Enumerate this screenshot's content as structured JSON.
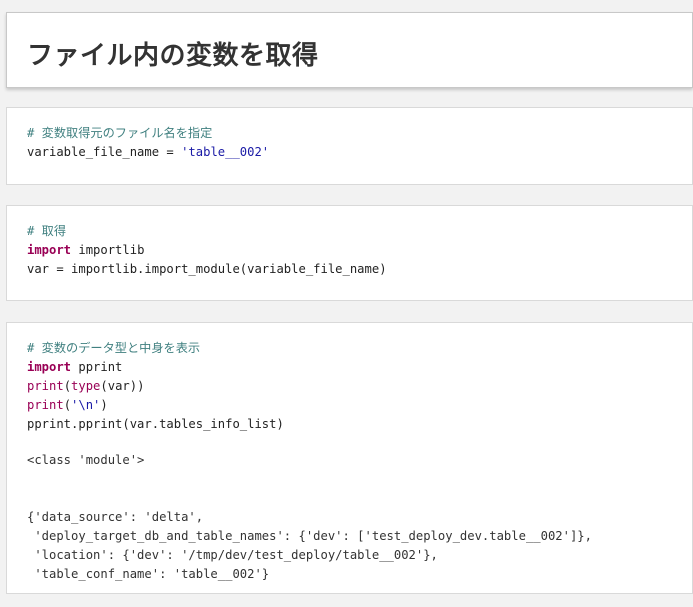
{
  "header": {
    "title": "ファイル内の変数を取得"
  },
  "cells": [
    {
      "lines": [
        [
          {
            "t": "# 変数取得元のファイル名を指定",
            "c": "comment"
          }
        ],
        [
          {
            "t": "variable_file_name = ",
            "c": "plain"
          },
          {
            "t": "'table__002'",
            "c": "str"
          }
        ]
      ]
    },
    {
      "lines": [
        [
          {
            "t": "# 取得",
            "c": "comment"
          }
        ],
        [
          {
            "t": "import",
            "c": "kw"
          },
          {
            "t": " importlib",
            "c": "plain"
          }
        ],
        [
          {
            "t": "var = importlib.import_module(variable_file_name)",
            "c": "plain"
          }
        ]
      ]
    },
    {
      "lines": [
        [
          {
            "t": "# 変数のデータ型と中身を表示",
            "c": "comment"
          }
        ],
        [
          {
            "t": "import",
            "c": "kw"
          },
          {
            "t": " pprint",
            "c": "plain"
          }
        ],
        [
          {
            "t": "print",
            "c": "builtin"
          },
          {
            "t": "(",
            "c": "plain"
          },
          {
            "t": "type",
            "c": "builtin"
          },
          {
            "t": "(var))",
            "c": "plain"
          }
        ],
        [
          {
            "t": "print",
            "c": "builtin"
          },
          {
            "t": "(",
            "c": "plain"
          },
          {
            "t": "'\\n'",
            "c": "str"
          },
          {
            "t": ")",
            "c": "plain"
          }
        ],
        [
          {
            "t": "pprint.pprint(var.tables_info_list)",
            "c": "plain"
          }
        ]
      ],
      "output_type": "<class 'module'>",
      "output_dict": "{'data_source': 'delta',\n 'deploy_target_db_and_table_names': {'dev': ['test_deploy_dev.table__002']},\n 'location': {'dev': '/tmp/dev/test_deploy/table__002'},\n 'table_conf_name': 'table__002'}"
    }
  ],
  "colors": {
    "comment": "#408080",
    "keyword": "#990055",
    "string": "#1a1aa6",
    "text": "#222222"
  }
}
